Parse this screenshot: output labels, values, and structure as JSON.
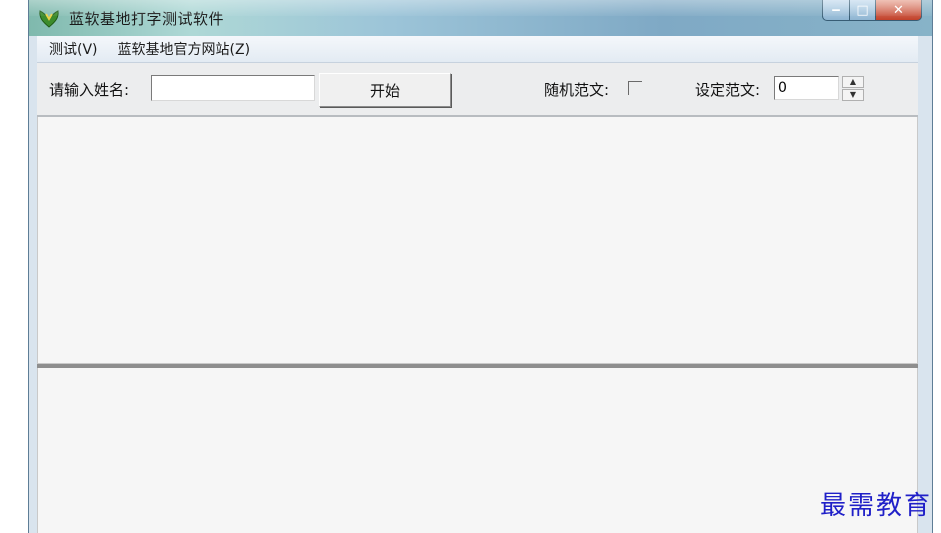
{
  "window": {
    "title": "蓝软基地打字测试软件",
    "icon": "app-logo-icon",
    "controls": {
      "minimize": "minimize-icon",
      "maximize": "maximize-icon",
      "close": "close-icon"
    }
  },
  "menubar": {
    "items": [
      {
        "label": "测试(V)"
      },
      {
        "label": "蓝软基地官方网站(Z)"
      }
    ]
  },
  "toolbar": {
    "name_label": "请输入姓名:",
    "name_value": "",
    "start_label": "开始",
    "random_label": "随机范文:",
    "random_checked": false,
    "set_label": "设定范文:",
    "set_value": "0"
  },
  "watermark": "最需教育",
  "colors": {
    "titlebar": "#9cc4d8",
    "close_button": "#c2412b",
    "watermark": "#2020c8"
  }
}
